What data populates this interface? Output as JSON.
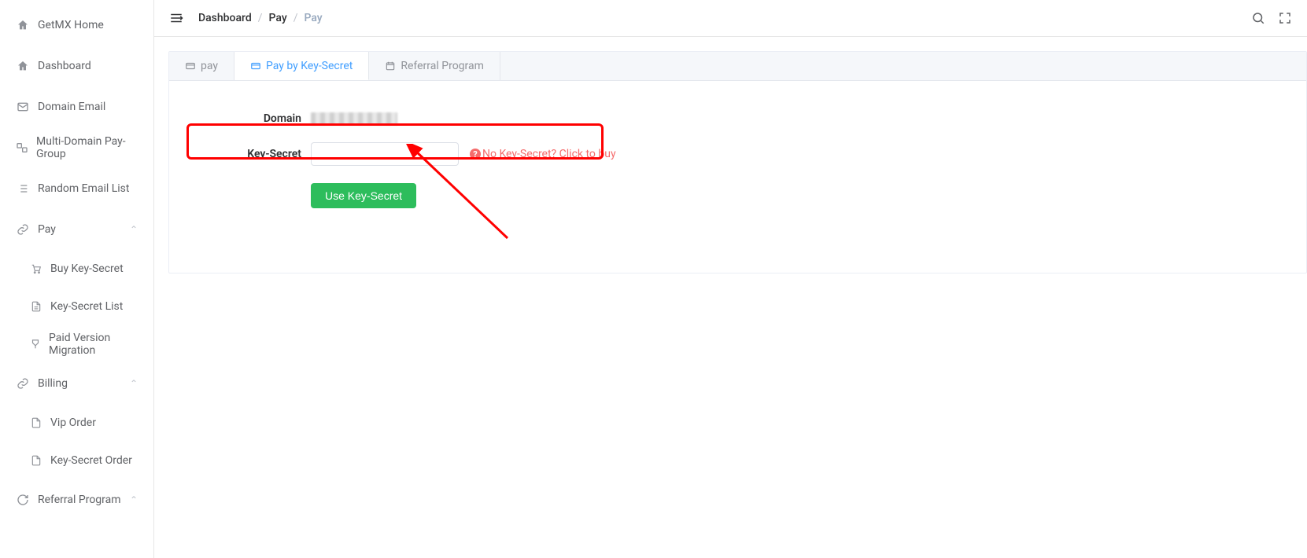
{
  "sidebar": {
    "items": [
      {
        "label": "GetMX Home",
        "icon": "home"
      },
      {
        "label": "Dashboard",
        "icon": "home"
      },
      {
        "label": "Domain Email",
        "icon": "mail-domain"
      },
      {
        "label": "Multi-Domain Pay-Group",
        "icon": "group"
      },
      {
        "label": "Random Email List",
        "icon": "list"
      }
    ],
    "pay": {
      "label": "Pay",
      "children": [
        {
          "label": "Buy Key-Secret",
          "icon": "cart"
        },
        {
          "label": "Key-Secret List",
          "icon": "doc"
        },
        {
          "label": "Paid Version Migration",
          "icon": "migrate"
        }
      ]
    },
    "billing": {
      "label": "Billing",
      "children": [
        {
          "label": "Vip Order",
          "icon": "doc"
        },
        {
          "label": "Key-Secret Order",
          "icon": "doc"
        }
      ]
    },
    "referral": {
      "label": "Referral Program"
    }
  },
  "breadcrumb": {
    "items": [
      "Dashboard",
      "Pay",
      "Pay"
    ]
  },
  "tabs": [
    {
      "label": "pay"
    },
    {
      "label": "Pay by Key-Secret"
    },
    {
      "label": "Referral Program"
    }
  ],
  "form": {
    "domain_label": "Domain",
    "keysecret_label": "Key-Secret",
    "keysecret_placeholder": "",
    "hint": "No Key-Secret? Click to buy",
    "submit": "Use Key-Secret"
  }
}
